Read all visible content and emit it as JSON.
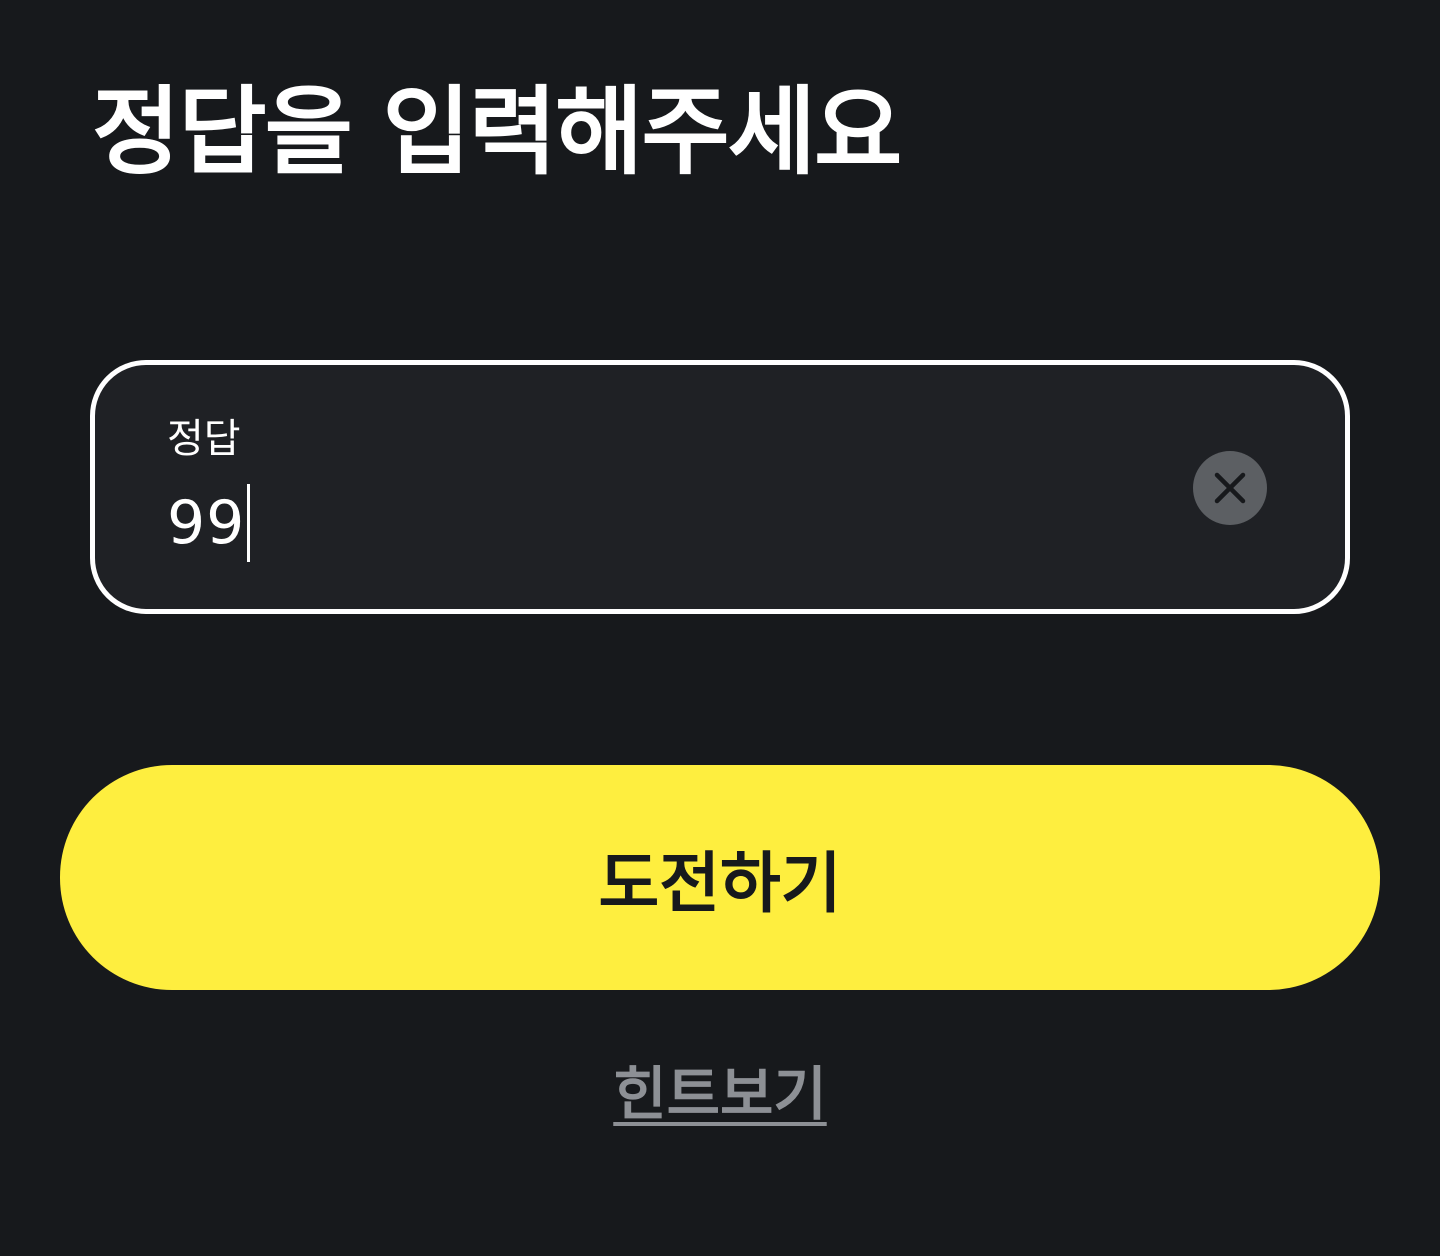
{
  "colors": {
    "background": "#17191c",
    "field_background": "#1f2125",
    "field_border": "#ffffff",
    "accent": "#feee3f",
    "clear_button": "#5c5f63",
    "hint_text": "#8d9095"
  },
  "header": {
    "title": "정답을 입력해주세요"
  },
  "answer_field": {
    "label": "정답",
    "value": "99",
    "clear_icon": "close-icon"
  },
  "actions": {
    "submit_label": "도전하기",
    "hint_label": "힌트보기"
  }
}
